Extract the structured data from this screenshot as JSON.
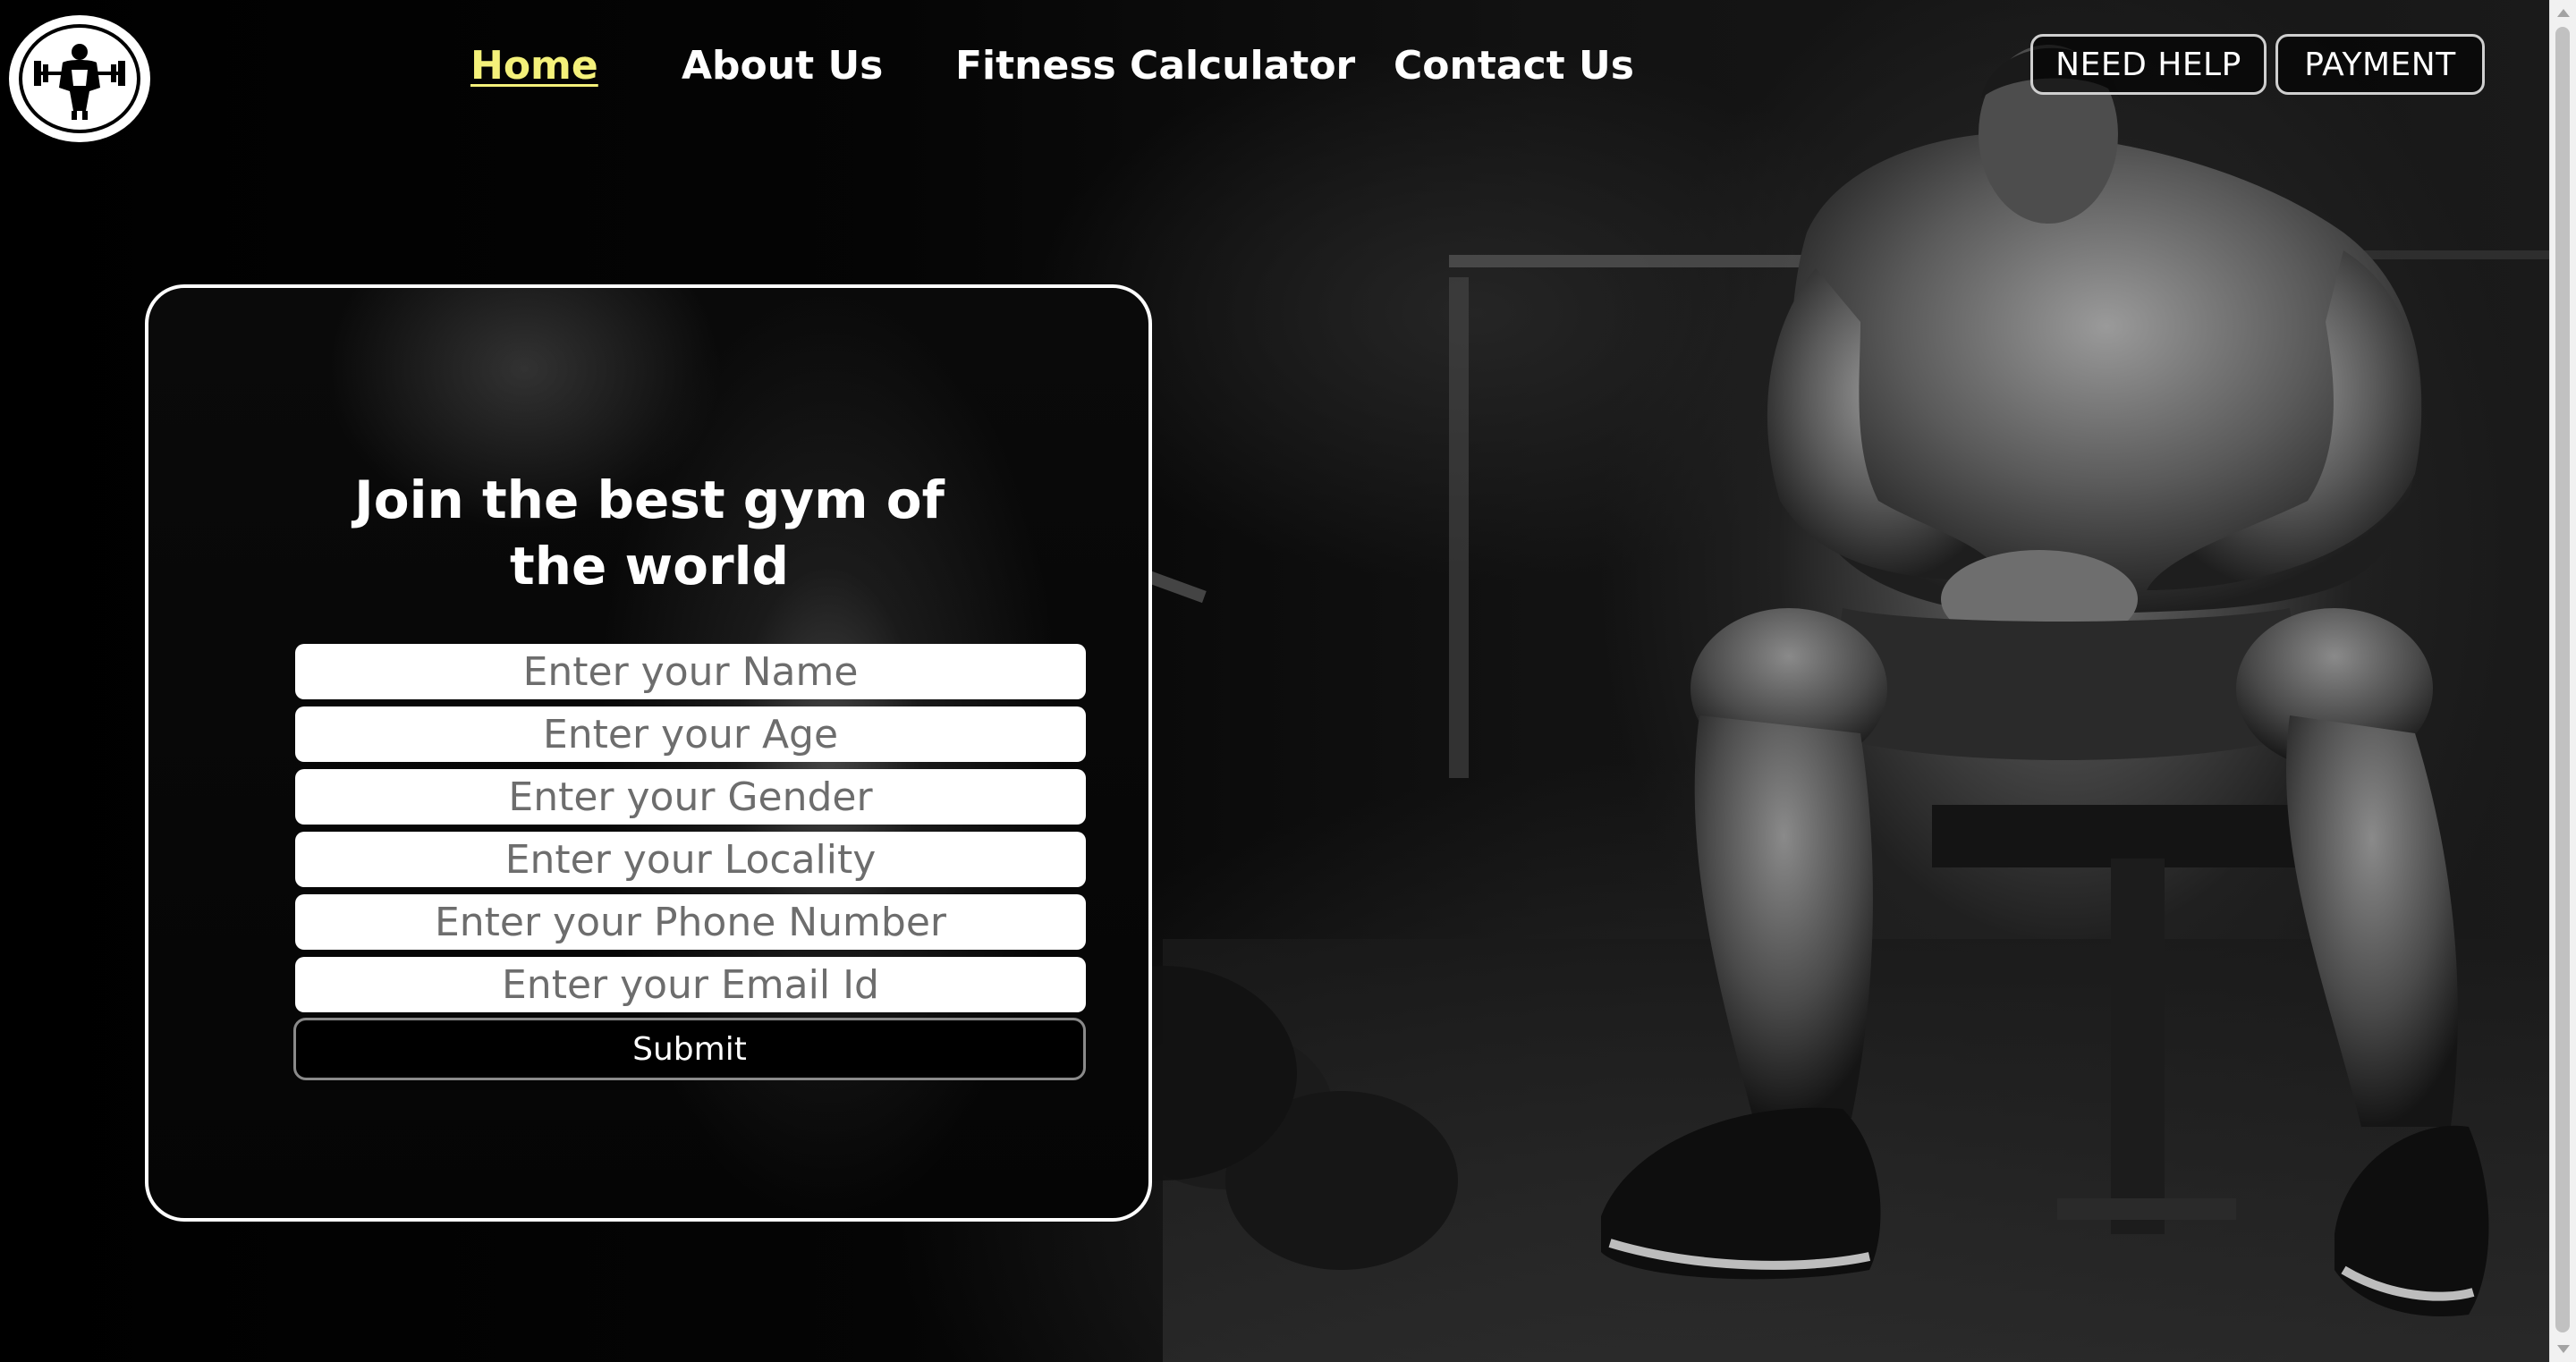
{
  "logo": {
    "icon": "bodybuilder-barbell-icon"
  },
  "nav": {
    "items": [
      {
        "label": "Home",
        "active": true
      },
      {
        "label": "About Us",
        "active": false
      },
      {
        "label": "Fitness Calculator",
        "active": false
      },
      {
        "label": "Contact Us",
        "active": false
      }
    ],
    "active_color": "#f4f17a"
  },
  "header_buttons": {
    "help": "NEED HELP",
    "payment": "PAYMENT"
  },
  "form": {
    "title": "Join the best gym of the world",
    "fields": [
      {
        "placeholder": "Enter your Name"
      },
      {
        "placeholder": "Enter your Age"
      },
      {
        "placeholder": "Enter your Gender"
      },
      {
        "placeholder": "Enter your Locality"
      },
      {
        "placeholder": "Enter your Phone Number"
      },
      {
        "placeholder": "Enter your Email Id"
      }
    ],
    "submit_label": "Submit"
  },
  "background": {
    "image": "bodybuilder-seated-gym-photo"
  }
}
